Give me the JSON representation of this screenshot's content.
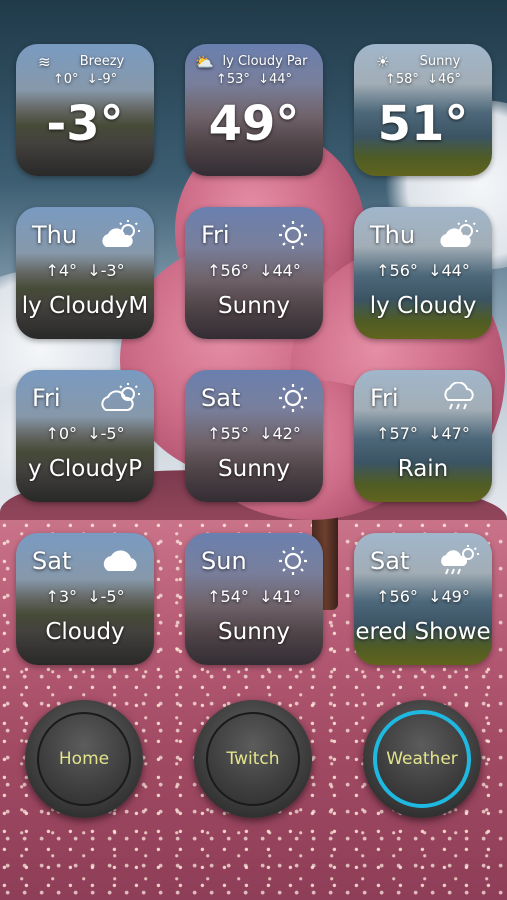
{
  "current": [
    {
      "condition": "Breezy",
      "hi": "↑0°",
      "lo": "↓-9°",
      "temp": "-3°",
      "icon": "wind-icon",
      "glyph": "≋"
    },
    {
      "condition": "ly Cloudy Par",
      "hi": "↑53°",
      "lo": "↓44°",
      "temp": "49°",
      "icon": "partly-cloudy-icon",
      "glyph": "⛅"
    },
    {
      "condition": "Sunny",
      "hi": "↑58°",
      "lo": "↓46°",
      "temp": "51°",
      "icon": "sun-icon",
      "glyph": "☀"
    }
  ],
  "forecast": [
    [
      {
        "day": "Thu",
        "hi": "↑4°",
        "lo": "↓-3°",
        "condition": "ly CloudyM",
        "icon": "partly-cloudy-icon"
      },
      {
        "day": "Fri",
        "hi": "↑56°",
        "lo": "↓44°",
        "condition": "Sunny",
        "icon": "sun-icon"
      },
      {
        "day": "Thu",
        "hi": "↑56°",
        "lo": "↓44°",
        "condition": "ly Cloudy",
        "icon": "partly-cloudy-icon"
      }
    ],
    [
      {
        "day": "Fri",
        "hi": "↑0°",
        "lo": "↓-5°",
        "condition": "y CloudyP",
        "icon": "partly-cloudy-icon"
      },
      {
        "day": "Sat",
        "hi": "↑55°",
        "lo": "↓42°",
        "condition": "Sunny",
        "icon": "sun-icon"
      },
      {
        "day": "Fri",
        "hi": "↑57°",
        "lo": "↓47°",
        "condition": "Rain",
        "icon": "rain-icon"
      }
    ],
    [
      {
        "day": "Sat",
        "hi": "↑3°",
        "lo": "↓-5°",
        "condition": "Cloudy",
        "icon": "cloud-icon"
      },
      {
        "day": "Sun",
        "hi": "↑54°",
        "lo": "↓41°",
        "condition": "Sunny",
        "icon": "sun-icon"
      },
      {
        "day": "Sat",
        "hi": "↑56°",
        "lo": "↓49°",
        "condition": "ered Showe",
        "icon": "scattered-showers-icon"
      }
    ]
  ],
  "nav": {
    "home": "Home",
    "twitch": "Twitch",
    "weather": "Weather",
    "active": "weather",
    "accent": "#1fb8e0",
    "label_color": "#e4e48c"
  }
}
